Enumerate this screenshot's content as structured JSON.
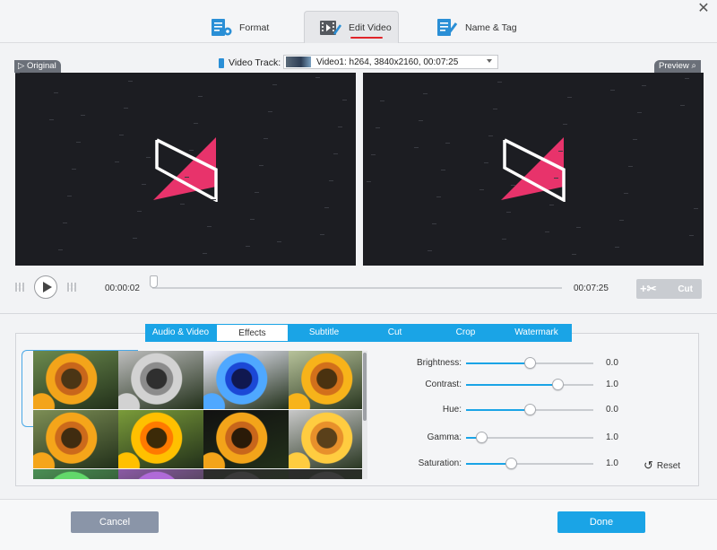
{
  "header": {
    "tabs": [
      {
        "label": "Format",
        "icon": "document-gear-icon"
      },
      {
        "label": "Edit Video",
        "icon": "film-edit-icon",
        "active": true
      },
      {
        "label": "Name & Tag",
        "icon": "document-pen-icon"
      }
    ],
    "close_icon": "close-icon",
    "underline_color": "#e1242a"
  },
  "video_track": {
    "label": "Video Track:",
    "value": "Video1: h264, 3840x2160, 00:07:25"
  },
  "preview": {
    "original_label": "Original",
    "preview_label": "Preview",
    "logo_color": "#e8336b"
  },
  "playback": {
    "current_time": "00:00:02",
    "total_time": "00:07:25",
    "position_fraction": 0.0045,
    "cut_label": "Cut"
  },
  "edit_tabs": [
    {
      "label": "Audio & Video"
    },
    {
      "label": "Effects",
      "active": true
    },
    {
      "label": "Subtitle"
    },
    {
      "label": "Cut"
    },
    {
      "label": "Crop"
    },
    {
      "label": "Watermark"
    }
  ],
  "effects": {
    "thumbnails": [
      "original",
      "grayscale",
      "blue-negative",
      "warm",
      "fisheye",
      "saturated",
      "vignette",
      "brightened",
      "green-tint",
      "purple",
      "dark",
      "dark"
    ]
  },
  "adjustments": [
    {
      "label": "Brightness:",
      "value": "0.0",
      "level": 0.5
    },
    {
      "label": "Contrast:",
      "value": "1.0",
      "level": 0.72
    },
    {
      "label": "Hue:",
      "value": "0.0",
      "level": 0.5
    },
    {
      "label": "Gamma:",
      "value": "1.0",
      "level": 0.12
    },
    {
      "label": "Saturation:",
      "value": "1.0",
      "level": 0.35
    }
  ],
  "reset_label": "Reset",
  "footer": {
    "cancel_label": "Cancel",
    "done_label": "Done"
  },
  "colors": {
    "accent": "#1aa4e6",
    "cancel": "#8a95a8"
  }
}
